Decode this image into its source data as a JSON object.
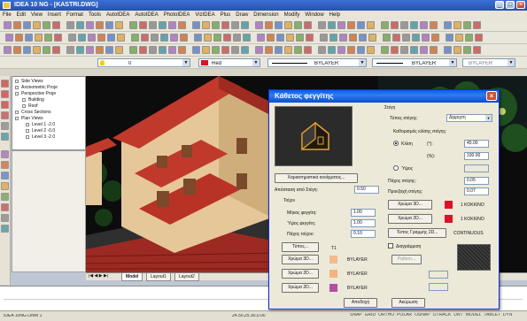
{
  "window": {
    "title": "IDEA 10 NG - [KASTRI.DWG]"
  },
  "menu": [
    "File",
    "Edit",
    "View",
    "Insert",
    "Format",
    "Tools",
    "AutoIDEA",
    "AutoIDEA",
    "PhotoIDEA",
    "VizIDEA",
    "Plus",
    "Draw",
    "Dimension",
    "Modify",
    "Window",
    "Help"
  ],
  "toolbar": {
    "layer_value": "0",
    "color_value": "Red",
    "linetype_value": "BYLAYER",
    "lineweight_value": "BYLAYER",
    "plotstyle_value": "BYLAYER"
  },
  "tree": {
    "items": [
      "Side Views",
      "Axonometric Proje",
      "Perspective Proje",
      "Building",
      "Roof",
      "Cross Sections",
      "Plan Views",
      "Level 1 -2.0",
      "Level 2 -0.0",
      "Level 3 -2.0"
    ]
  },
  "tabs": [
    "Model",
    "Layout1",
    "Layout2"
  ],
  "status": {
    "left": "IDEA 10NG Level 1",
    "coords": "24.50,25.30,0.00",
    "modes": [
      "SNAP",
      "GRID",
      "ORTHO",
      "POLAR",
      "OSNAP",
      "OTRACK",
      "LWT",
      "MODEL",
      "TABLET",
      "DYN"
    ]
  },
  "dialog": {
    "title": "Κάθετος φεγγίτης",
    "props_button": "Χαρακτηριστικά ανοίγματος...",
    "dist_label": "Απόσταση από Στέγη:",
    "dist_value": "0.50",
    "wall_section": "Τοίχοι",
    "wall_len_label": "Μήκος φεγγίτη:",
    "wall_len_value": "1.00",
    "wall_height_label": "Ύψος φεγγίτη:",
    "wall_height_value": "1.00",
    "wall_thick_label": "Πάχος τοίχου:",
    "wall_thick_value": "0.10",
    "type_button": "Τύπος...",
    "type_col": "T1",
    "colors": [
      {
        "label": "Χρώμα 3D...",
        "value": "BYLAYER",
        "swatch": "#f5b98e"
      },
      {
        "label": "Χρώμα 2D...",
        "value": "BYLAYER",
        "swatch": "#f2b37f"
      },
      {
        "label": "Χρώμα 2D...",
        "value": "BYLAYER",
        "swatch": "#b44ca8"
      }
    ],
    "roof_section": "Στέγη",
    "roof_type_label": "Τύπος στέγης:",
    "roof_type_value": "Δίρριχτη",
    "slope_label": "Καθορισμός κλίσης στέγης:",
    "radio_slope": "Κλίση",
    "radio_slope_unit": "(°):",
    "radio_slope_value": "45.00",
    "radio_pct_unit": "(%):",
    "radio_pct_value": "100.00",
    "radio_height": "Ύψος",
    "roof_thick_label": "Πάχος στέγης:",
    "roof_thick_value": "0.05",
    "overhang_label": "Προεξοχή στέγης:",
    "overhang_value": "0.07",
    "roof_colors": [
      {
        "label": "Χρώμα 3D...",
        "value": "1 ΚΟΚΚΙΝΟ",
        "swatch": "#e0102a"
      },
      {
        "label": "Χρώμα 2D...",
        "value": "1 ΚΟΚΚΙΝΟ",
        "swatch": "#e0102a"
      }
    ],
    "linetype_button": "Τύπος Γραμμής 2D...",
    "linetype_value": "CONTINUOUS",
    "hatch_label": "Διαγράμμιση",
    "pattern_button": "Pattern...",
    "ok_button": "Αποδοχή",
    "cancel_button": "Ακύρωση"
  }
}
